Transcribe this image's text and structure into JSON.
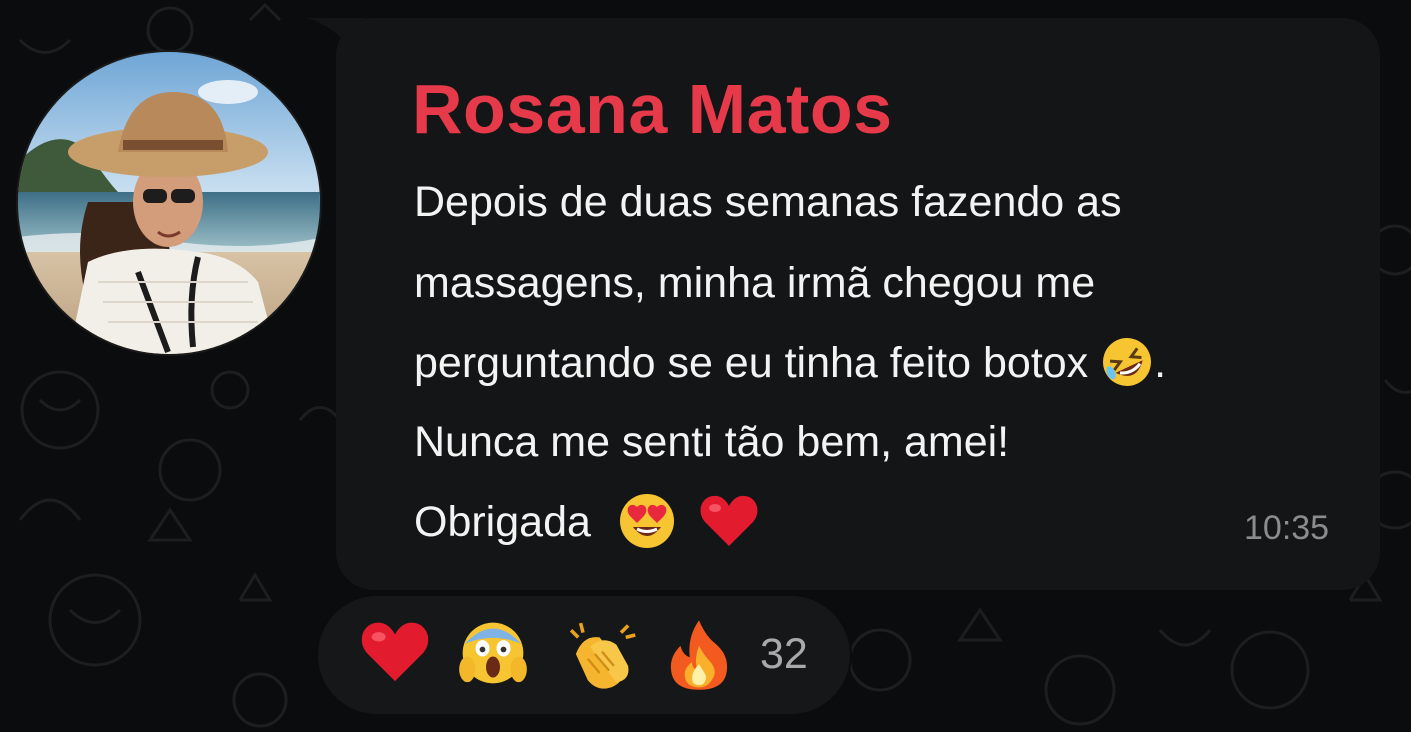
{
  "message": {
    "sender_name": "Rosana Matos",
    "lines": [
      "Depois de duas semanas fazendo as",
      "massagens, minha irmã chegou me",
      "perguntando se eu tinha feito botox",
      "Nunca me senti tão bem, amei!",
      "Obrigada"
    ],
    "line3_suffix": ".",
    "time": "10:35"
  },
  "avatar": {
    "icon": "profile-photo-woman-beach"
  },
  "reactions": {
    "emojis": [
      "red-heart",
      "face-screaming-in-fear",
      "clapping-hands",
      "fire"
    ],
    "count": "32"
  },
  "colors": {
    "sender_name": "#e63a4a",
    "bubble": "#141516",
    "background": "#0b0c0d",
    "time": "#8a8c8e"
  }
}
